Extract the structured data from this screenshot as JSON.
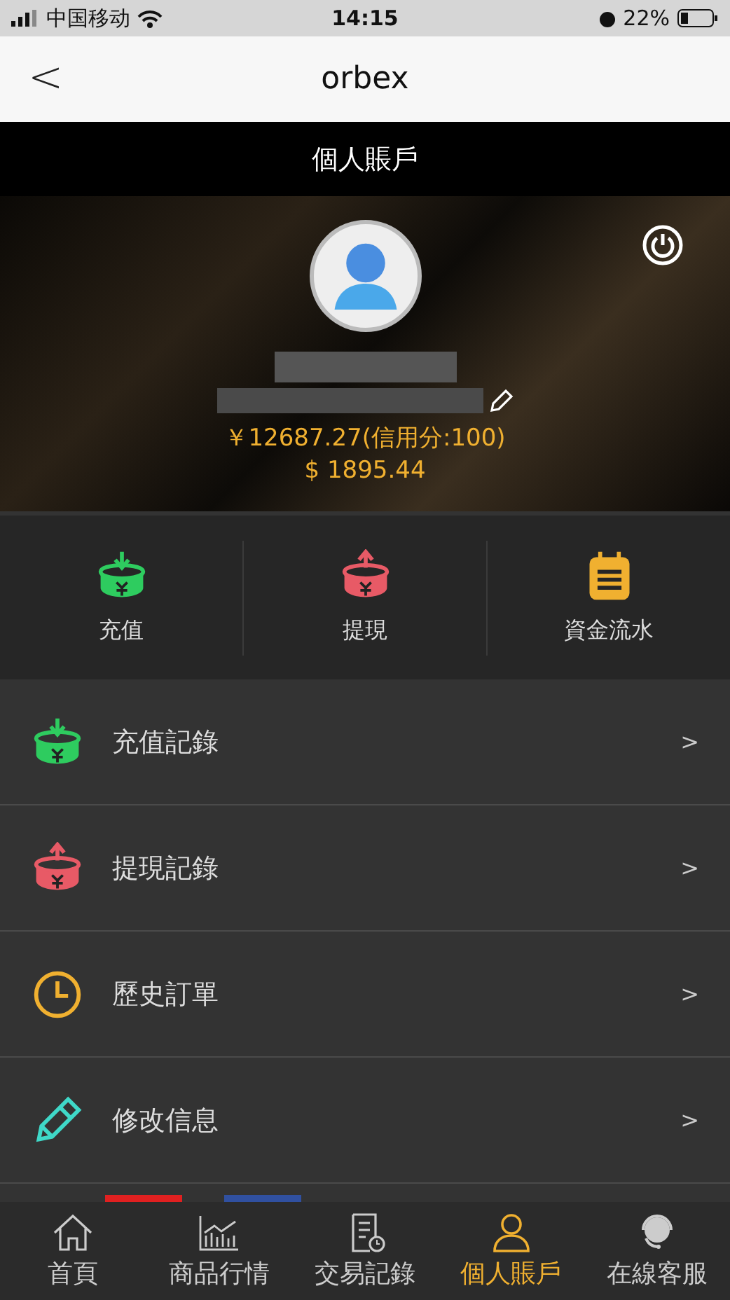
{
  "status_bar": {
    "carrier": "中国移动",
    "time": "14:15",
    "battery": "22%"
  },
  "nav": {
    "back": "<",
    "title": "orbex"
  },
  "page_title": "個人賬戶",
  "profile": {
    "balance_cny": "￥12687.27(信用分:100)",
    "balance_usd": "$ 1895.44"
  },
  "actions": [
    {
      "kind": "deposit",
      "label": "充值"
    },
    {
      "kind": "withdraw",
      "label": "提現"
    },
    {
      "kind": "ledger",
      "label": "資金流水"
    }
  ],
  "menu": [
    {
      "kind": "deposit",
      "label": "充值記錄",
      "chevron": ">"
    },
    {
      "kind": "withdraw",
      "label": "提現記錄",
      "chevron": ">"
    },
    {
      "kind": "history",
      "label": "歷史訂單",
      "chevron": ">"
    },
    {
      "kind": "edit",
      "label": "修改信息",
      "chevron": ">"
    }
  ],
  "tabs": [
    {
      "kind": "home",
      "label": "首頁",
      "selected": false
    },
    {
      "kind": "market",
      "label": "商品行情",
      "selected": false
    },
    {
      "kind": "records",
      "label": "交易記錄",
      "selected": false
    },
    {
      "kind": "account",
      "label": "個人賬戶",
      "selected": true
    },
    {
      "kind": "support",
      "label": "在線客服",
      "selected": false
    }
  ]
}
